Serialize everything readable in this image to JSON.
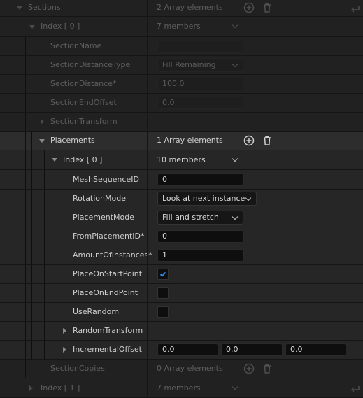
{
  "sections": {
    "label": "Sections",
    "value": "2 Array elements",
    "index0": {
      "label": "Index [ 0 ]",
      "value": "7 members",
      "section_name": {
        "label": "SectionName",
        "value": ""
      },
      "section_distance_type": {
        "label": "SectionDistanceType",
        "value": "Fill Remaining"
      },
      "section_distance": {
        "label": "SectionDistance*",
        "value": "100.0"
      },
      "section_end_offset": {
        "label": "SectionEndOffset",
        "value": "0.0"
      },
      "section_transform": {
        "label": "SectionTransform"
      },
      "placements": {
        "label": "Placements",
        "value": "1 Array elements",
        "index0": {
          "label": "Index [ 0 ]",
          "value": "10 members",
          "mesh_sequence_id": {
            "label": "MeshSequenceID",
            "value": "0"
          },
          "rotation_mode": {
            "label": "RotationMode",
            "value": "Look at next instance"
          },
          "placement_mode": {
            "label": "PlacementMode",
            "value": "Fill and stretch"
          },
          "from_placement_id": {
            "label": "FromPlacementID*",
            "value": "0"
          },
          "amount_of_instances": {
            "label": "AmountOfInstances*",
            "value": "1"
          },
          "place_on_start_point": {
            "label": "PlaceOnStartPoint",
            "checked": true
          },
          "place_on_end_point": {
            "label": "PlaceOnEndPoint",
            "checked": false
          },
          "use_random": {
            "label": "UseRandom",
            "checked": false
          },
          "random_transform": {
            "label": "RandomTransform"
          },
          "incremental_offset": {
            "label": "IncrementalOffset",
            "x": "0.0",
            "y": "0.0",
            "z": "0.0"
          }
        }
      },
      "section_copies": {
        "label": "SectionCopies",
        "value": "0 Array elements"
      }
    },
    "index1": {
      "label": "Index [ 1 ]",
      "value": "7 members"
    }
  },
  "colors": {
    "check_accent": "#2f8ff0",
    "row_highlight": "#2d2d2d"
  },
  "icons": [
    "add-icon",
    "trash-icon",
    "reset-arrow-icon",
    "chevron-down-icon",
    "expand-arrow-icon"
  ]
}
